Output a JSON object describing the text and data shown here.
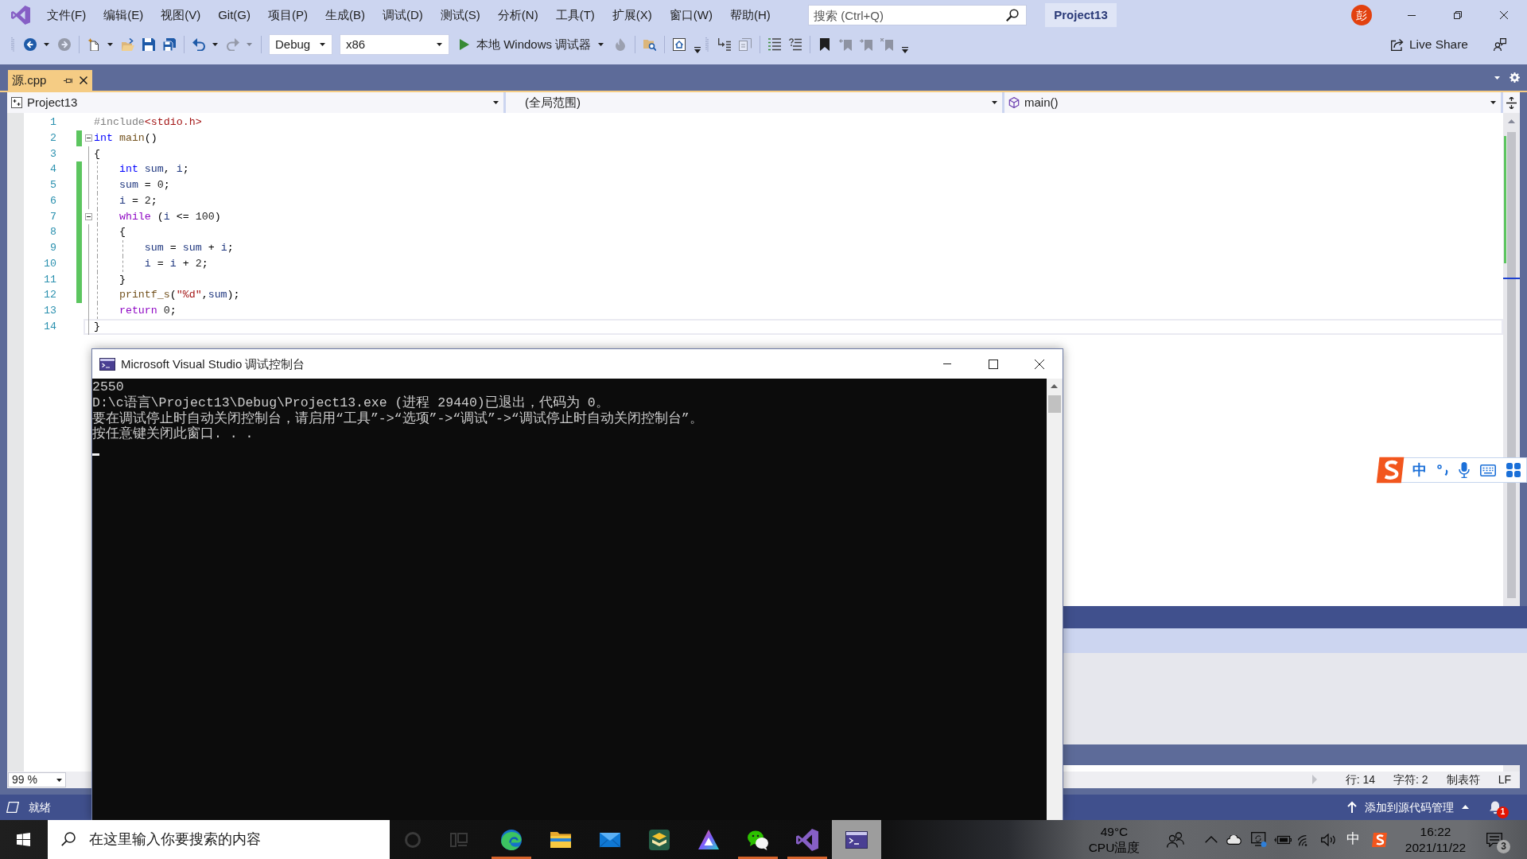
{
  "title_bar": {
    "menus": [
      "文件(F)",
      "编辑(E)",
      "视图(V)",
      "Git(G)",
      "项目(P)",
      "生成(B)",
      "调试(D)",
      "测试(S)",
      "分析(N)",
      "工具(T)",
      "扩展(X)",
      "窗口(W)",
      "帮助(H)"
    ],
    "search": {
      "placeholder": "搜索 (Ctrl+Q)"
    },
    "solution": "Project13",
    "account_initial": "彭"
  },
  "toolbar": {
    "bands": [
      {
        "groups": [
          [
            {
              "kind": "back",
              "disabled": false,
              "dropdown": true
            },
            {
              "kind": "forward",
              "disabled": true,
              "dropdown": false
            }
          ],
          [
            {
              "kind": "newitem",
              "disabled": false,
              "dropdown": true
            },
            {
              "kind": "open",
              "disabled": false,
              "dropdown": false
            },
            {
              "kind": "save",
              "disabled": false,
              "dropdown": false
            },
            {
              "kind": "saveall",
              "disabled": false,
              "dropdown": false
            }
          ],
          [
            {
              "kind": "undo",
              "disabled": false,
              "dropdown": true
            },
            {
              "kind": "redo",
              "disabled": true,
              "dropdown": true
            }
          ],
          [
            {
              "kind": "combo",
              "value": "Debug",
              "disabled": false
            },
            {
              "kind": "combo",
              "value": "x86",
              "disabled": false
            },
            {
              "kind": "run",
              "label": "本地 Windows 调试器",
              "disabled": false,
              "dropdown": true
            },
            {
              "kind": "hotreload",
              "disabled": true,
              "dropdown": false
            }
          ],
          [
            {
              "kind": "findfiles",
              "disabled": false,
              "dropdown": false
            }
          ],
          [
            {
              "kind": "browse",
              "disabled": false,
              "dropdown": false
            }
          ]
        ]
      },
      {
        "groups": [
          [
            {
              "kind": "stepinto",
              "disabled": false,
              "dropdown": false
            },
            {
              "kind": "stack",
              "disabled": true,
              "dropdown": false
            }
          ],
          [
            {
              "kind": "comment",
              "disabled": false,
              "dropdown": false
            },
            {
              "kind": "uncomment",
              "disabled": false,
              "dropdown": false
            }
          ],
          [
            {
              "kind": "bookmark",
              "disabled": false,
              "dropdown": false
            },
            {
              "kind": "prevbookmark",
              "disabled": true,
              "dropdown": false
            },
            {
              "kind": "nextbookmark",
              "disabled": true,
              "dropdown": false
            },
            {
              "kind": "clearbookmark",
              "disabled": true,
              "dropdown": false
            }
          ]
        ]
      }
    ],
    "live_share": "Live Share"
  },
  "document_tabs": [
    {
      "label": "源.cpp",
      "selected": true,
      "pinned": false
    }
  ],
  "navigation_bar": {
    "project": "Project13",
    "scope": "(全局范围)",
    "member": "main()"
  },
  "editor": {
    "lines": [
      {
        "number": "1",
        "changed": false,
        "current": false,
        "tokens": [
          {
            "kind": "preprocessor",
            "text": "#include"
          },
          {
            "kind": "header",
            "text": "<stdio.h>"
          }
        ]
      },
      {
        "number": "2",
        "changed": true,
        "current": false,
        "expanded": true,
        "tokens": [
          {
            "kind": "keyword",
            "text": "int"
          },
          {
            "kind": "function",
            "text": " main"
          },
          {
            "kind": "plain",
            "text": "()"
          }
        ]
      },
      {
        "number": "3",
        "changed": false,
        "current": false,
        "tokens": [
          {
            "kind": "plain",
            "text": "{"
          }
        ]
      },
      {
        "number": "4",
        "changed": true,
        "current": false,
        "tokens": [
          {
            "kind": "keyword",
            "text": "    int"
          },
          {
            "kind": "variable",
            "text": " sum"
          },
          {
            "kind": "plain",
            "text": ", "
          },
          {
            "kind": "variable",
            "text": "i"
          },
          {
            "kind": "plain",
            "text": ";"
          }
        ]
      },
      {
        "number": "5",
        "changed": true,
        "current": false,
        "tokens": [
          {
            "kind": "variable",
            "text": "    sum"
          },
          {
            "kind": "plain",
            "text": " = "
          },
          {
            "kind": "number",
            "text": "0"
          },
          {
            "kind": "plain",
            "text": ";"
          }
        ]
      },
      {
        "number": "6",
        "changed": true,
        "current": false,
        "tokens": [
          {
            "kind": "variable",
            "text": "    i"
          },
          {
            "kind": "plain",
            "text": " = "
          },
          {
            "kind": "number",
            "text": "2"
          },
          {
            "kind": "plain",
            "text": ";"
          }
        ]
      },
      {
        "number": "7",
        "changed": true,
        "current": false,
        "expanded": true,
        "tokens": [
          {
            "kind": "control",
            "text": "    while"
          },
          {
            "kind": "plain",
            "text": " ("
          },
          {
            "kind": "variable",
            "text": "i"
          },
          {
            "kind": "plain",
            "text": " <= "
          },
          {
            "kind": "number",
            "text": "100"
          },
          {
            "kind": "plain",
            "text": ")"
          }
        ]
      },
      {
        "number": "8",
        "changed": true,
        "current": false,
        "tokens": [
          {
            "kind": "plain",
            "text": "    {"
          }
        ]
      },
      {
        "number": "9",
        "changed": true,
        "current": false,
        "tokens": [
          {
            "kind": "variable",
            "text": "        sum"
          },
          {
            "kind": "plain",
            "text": " = "
          },
          {
            "kind": "variable",
            "text": "sum"
          },
          {
            "kind": "plain",
            "text": " + "
          },
          {
            "kind": "variable",
            "text": "i"
          },
          {
            "kind": "plain",
            "text": ";"
          }
        ]
      },
      {
        "number": "10",
        "changed": true,
        "current": false,
        "tokens": [
          {
            "kind": "variable",
            "text": "        i"
          },
          {
            "kind": "plain",
            "text": " = "
          },
          {
            "kind": "variable",
            "text": "i"
          },
          {
            "kind": "plain",
            "text": " + "
          },
          {
            "kind": "number",
            "text": "2"
          },
          {
            "kind": "plain",
            "text": ";"
          }
        ]
      },
      {
        "number": "11",
        "changed": true,
        "current": false,
        "tokens": [
          {
            "kind": "plain",
            "text": "    }"
          }
        ]
      },
      {
        "number": "12",
        "changed": true,
        "current": false,
        "tokens": [
          {
            "kind": "function",
            "text": "    printf_s"
          },
          {
            "kind": "plain",
            "text": "("
          },
          {
            "kind": "string",
            "text": "\"%d\""
          },
          {
            "kind": "plain",
            "text": ","
          },
          {
            "kind": "variable",
            "text": "sum"
          },
          {
            "kind": "plain",
            "text": ");"
          }
        ]
      },
      {
        "number": "13",
        "changed": false,
        "current": false,
        "tokens": [
          {
            "kind": "control",
            "text": "    return"
          },
          {
            "kind": "number",
            "text": " 0"
          },
          {
            "kind": "plain",
            "text": ";"
          }
        ]
      },
      {
        "number": "14",
        "changed": false,
        "current": true,
        "tokens": [
          {
            "kind": "plain",
            "text": "}"
          }
        ]
      }
    ]
  },
  "editor_footer": {
    "zoom": "99 %",
    "line": "行: 14",
    "column": "字符: 2",
    "indentation": "制表符",
    "line_ending": "LF"
  },
  "status_bar": {
    "text": "就绪",
    "source_control": "添加到源代码管理",
    "notification_count": "1"
  },
  "console_window": {
    "title": "Microsoft Visual Studio 调试控制台",
    "lines": [
      "2550",
      "D:\\c语言\\Project13\\Debug\\Project13.exe (进程 29440)已退出，代码为 0。",
      "要在调试停止时自动关闭控制台，请启用“工具”->“选项”->“调试”->“调试停止时自动关闭控制台”。",
      "按任意键关闭此窗口. . ."
    ]
  },
  "ime_toolbar": {
    "mode": "中"
  },
  "taskbar": {
    "search": {
      "placeholder": "在这里输入你要搜索的内容"
    },
    "apps": [
      {
        "kind": "browser",
        "selected": false,
        "notifying": true
      },
      {
        "kind": "folder",
        "selected": false,
        "notifying": false
      },
      {
        "kind": "mail",
        "selected": false,
        "notifying": false
      },
      {
        "kind": "tile",
        "selected": false,
        "notifying": false
      },
      {
        "kind": "triangle",
        "selected": false,
        "notifying": false
      },
      {
        "kind": "chat",
        "selected": false,
        "notifying": true
      },
      {
        "kind": "ide",
        "selected": false,
        "notifying": true
      },
      {
        "kind": "terminal",
        "selected": true,
        "notifying": false
      }
    ],
    "tray": {
      "temperature": "49°C",
      "temperature_label": "CPU温度",
      "input_mode": "中",
      "time": "16:22",
      "date": "2021/11/22",
      "notification_count": "3"
    }
  }
}
